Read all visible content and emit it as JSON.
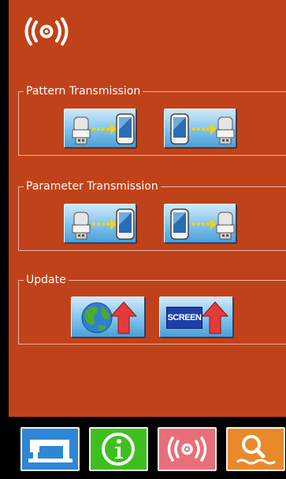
{
  "status": {
    "icon": "wireless-signal-icon"
  },
  "groups": [
    {
      "title": "Pattern Transmission",
      "buttons": [
        {
          "icon": "usb-to-panel-icon"
        },
        {
          "icon": "panel-to-usb-icon"
        }
      ]
    },
    {
      "title": "Parameter Transmission",
      "buttons": [
        {
          "icon": "usb-to-panel-icon"
        },
        {
          "icon": "panel-to-usb-icon"
        }
      ]
    },
    {
      "title": "Update",
      "buttons": [
        {
          "icon": "globe-upload-icon"
        },
        {
          "icon": "screen-upload-icon",
          "label": "SCREEN"
        }
      ]
    }
  ],
  "bottom_nav": [
    {
      "icon": "sewing-machine-icon",
      "color": "#2f86d6"
    },
    {
      "icon": "info-icon",
      "color": "#3fbf1f"
    },
    {
      "icon": "wireless-signal-icon",
      "color": "#e86f7a"
    },
    {
      "icon": "search-icon",
      "color": "#e88a2b"
    }
  ],
  "colors": {
    "background": "#c0421a",
    "frame": "#000000"
  }
}
